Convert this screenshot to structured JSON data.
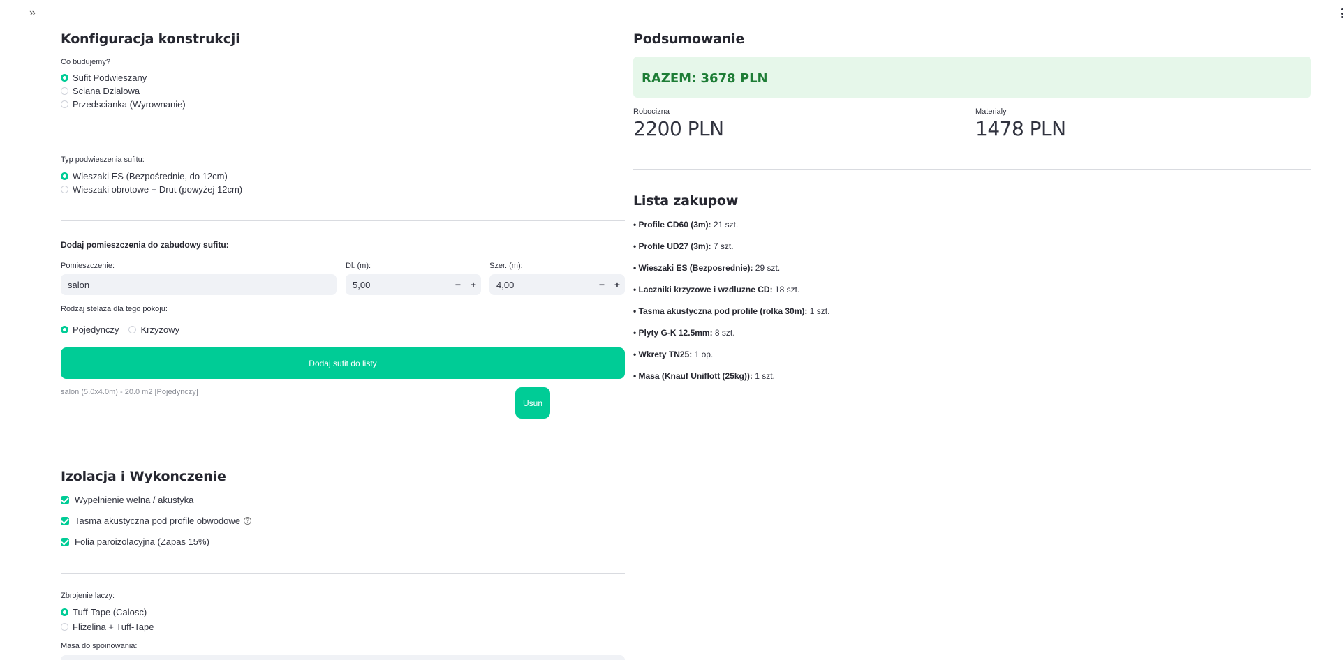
{
  "icons": {
    "sidebar_toggle": "»",
    "menu": "more-vertical-icon"
  },
  "colors": {
    "accent": "#00cc96",
    "total_bg": "#e6f7ea",
    "total_text": "#1e7d36"
  },
  "config": {
    "title": "Konfiguracja konstrukcji",
    "build_label": "Co budujemy?",
    "build_options": [
      "Sufit Podwieszany",
      "Sciana Dzialowa",
      "Przedscianka (Wyrownanie)"
    ],
    "build_selected": 0,
    "suspension_label": "Typ podwieszenia sufitu:",
    "suspension_options": [
      "Wieszaki ES (Bezpośrednie, do 12cm)",
      "Wieszaki obrotowe + Drut (powyżej 12cm)"
    ],
    "suspension_selected": 0,
    "rooms_header": "Dodaj pomieszczenia do zabudowy sufitu:",
    "room_label": "Pomieszczenie:",
    "room_value": "salon",
    "length_label": "Dl. (m):",
    "length_value": "5,00",
    "width_label": "Szer. (m):",
    "width_value": "4,00",
    "minus": "−",
    "plus": "+",
    "frame_label": "Rodzaj stelaza dla tego pokoju:",
    "frame_options": [
      "Pojedynczy",
      "Krzyzowy"
    ],
    "frame_selected": 0,
    "add_button": "Dodaj sufit do listy",
    "room_entry": "salon (5.0x4.0m) - 20.0 m2 [Pojedynczy]",
    "remove_button": "Usun"
  },
  "insulation": {
    "title": "Izolacja i Wykonczenie",
    "options": [
      "Wypelnienie welna / akustyka",
      "Tasma akustyczna pod profile obwodowe",
      "Folia paroizolacyjna (Zapas 15%)"
    ],
    "help_glyph": "?"
  },
  "joints": {
    "label": "Zbrojenie laczy:",
    "options": [
      "Tuff-Tape (Calosc)",
      "Flizelina + Tuff-Tape"
    ],
    "selected": 0,
    "compound_label": "Masa do spoinowania:"
  },
  "summary": {
    "title": "Podsumowanie",
    "total": "RAZEM: 3678 PLN",
    "labor_label": "Robocizna",
    "labor_value": "2200 PLN",
    "materials_label": "Materialy",
    "materials_value": "1478 PLN"
  },
  "shopping": {
    "title": "Lista zakupow",
    "items": [
      {
        "name": "• Profile CD60 (3m):",
        "qty": " 21 szt."
      },
      {
        "name": "• Profile UD27 (3m):",
        "qty": " 7 szt."
      },
      {
        "name": "• Wieszaki ES (Bezposrednie):",
        "qty": " 29 szt."
      },
      {
        "name": "• Laczniki krzyzowe i wzdluzne CD:",
        "qty": " 18 szt."
      },
      {
        "name": "• Tasma akustyczna pod profile (rolka 30m):",
        "qty": " 1 szt."
      },
      {
        "name": "• Plyty G-K 12.5mm:",
        "qty": " 8 szt."
      },
      {
        "name": "• Wkrety TN25:",
        "qty": " 1 op."
      },
      {
        "name": "• Masa (Knauf Uniflott (25kg)):",
        "qty": " 1 szt."
      }
    ]
  }
}
